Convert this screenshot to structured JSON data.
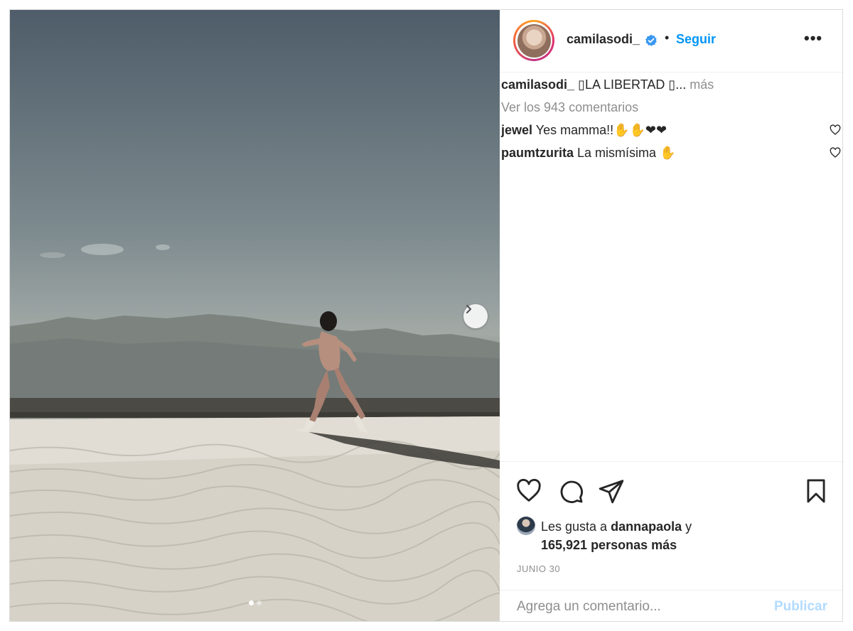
{
  "post": {
    "username": "camilasodi_",
    "verified_icon": "verified-badge-icon",
    "separator": "•",
    "follow_label": "Seguir",
    "more_label": "•••",
    "caption": {
      "username": "camilasodi_",
      "text": "▯LA LIBERTAD ▯...",
      "more": "más"
    },
    "view_comments": "Ver los 943 comentarios",
    "comments": [
      {
        "user": "jewel",
        "text": "Yes mamma!!✋✋❤❤"
      },
      {
        "user": "paumtzurita",
        "text": "La mismísima ✋"
      }
    ],
    "likes": {
      "prefix": "Les gusta a",
      "user": "dannapaola",
      "conj": "y",
      "count_text": "165,921 personas más"
    },
    "date": "JUNIO 30",
    "comment_placeholder": "Agrega un comentario...",
    "publish_label": "Publicar",
    "carousel": {
      "total": 2,
      "current": 1
    }
  },
  "colors": {
    "accent": "#0095f6",
    "publish_disabled": "#b3dbff",
    "muted": "#8e8e8e",
    "text": "#262626"
  }
}
